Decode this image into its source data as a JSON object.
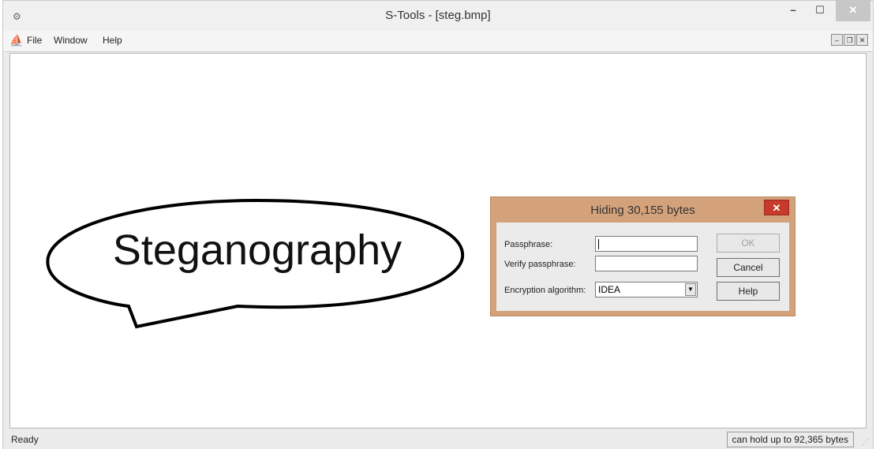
{
  "window": {
    "title": "S-Tools - [steg.bmp]"
  },
  "menu": {
    "items": [
      "File",
      "Window",
      "Help"
    ]
  },
  "canvas": {
    "bubble_text": "Steganography"
  },
  "dialog": {
    "title": "Hiding 30,155 bytes",
    "passphrase_label": "Passphrase:",
    "passphrase_value": "",
    "verify_label": "Verify passphrase:",
    "verify_value": "",
    "algorithm_label": "Encryption algorithm:",
    "algorithm_value": "IDEA",
    "ok_label": "OK",
    "cancel_label": "Cancel",
    "help_label": "Help"
  },
  "status": {
    "left": "Ready",
    "right": "can hold up to 92,365 bytes"
  },
  "icons": {
    "app": "s-tools-app-icon",
    "menu": "s-tools-menu-icon"
  },
  "colors": {
    "dialog_frame": "#d4a27a",
    "dialog_close": "#c83a2b"
  }
}
